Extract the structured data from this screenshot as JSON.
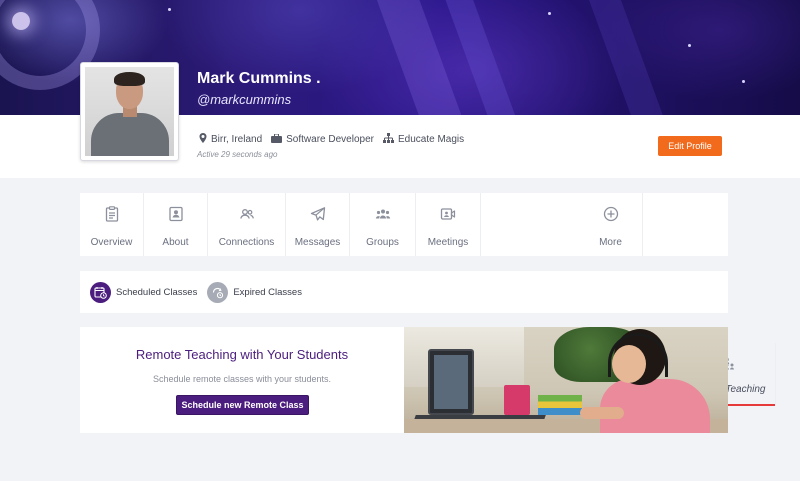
{
  "profile": {
    "name": "Mark Cummins .",
    "handle": "@markcummins",
    "location": "Birr, Ireland",
    "role": "Software Developer",
    "organization": "Educate Magis",
    "active": "Active 29 seconds ago",
    "edit_label": "Edit Profile"
  },
  "tabs": [
    {
      "label": "Overview",
      "icon": "clipboard-icon"
    },
    {
      "label": "About",
      "icon": "id-card-icon"
    },
    {
      "label": "Connections",
      "icon": "people-icon"
    },
    {
      "label": "Messages",
      "icon": "paper-plane-icon"
    },
    {
      "label": "Groups",
      "icon": "group-icon"
    },
    {
      "label": "Meetings",
      "icon": "video-camera-icon"
    },
    {
      "label": "Remote Teaching",
      "icon": "classroom-icon",
      "active": true
    },
    {
      "label": "More",
      "icon": "plus-circle-icon"
    }
  ],
  "subnav": {
    "scheduled": "Scheduled Classes",
    "expired": "Expired Classes"
  },
  "banner": {
    "title": "Remote Teaching with Your Students",
    "subtitle": "Schedule remote classes with your students.",
    "cta": "Schedule new Remote Class"
  },
  "colors": {
    "accent_orange": "#f26b1d",
    "brand_purple": "#4b1d7e",
    "active_tab_underline": "#e63939"
  }
}
